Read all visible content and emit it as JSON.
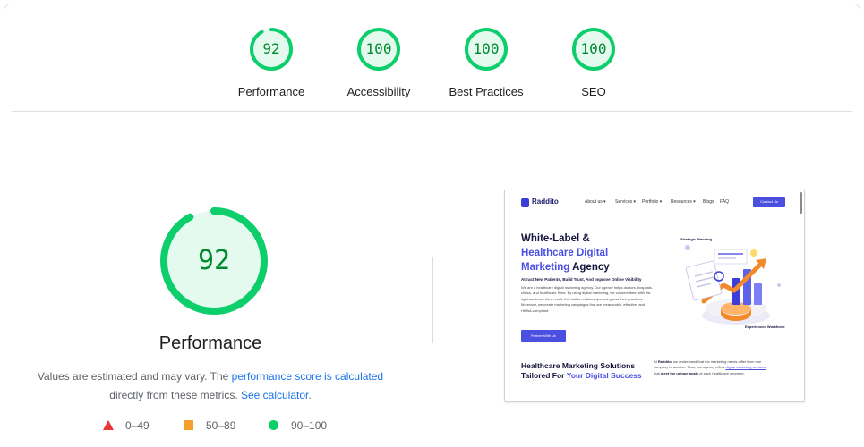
{
  "summary": {
    "categories": [
      {
        "label": "Performance",
        "score": "92",
        "fraction": 0.92
      },
      {
        "label": "Accessibility",
        "score": "100",
        "fraction": 1.0
      },
      {
        "label": "Best Practices",
        "score": "100",
        "fraction": 1.0
      },
      {
        "label": "SEO",
        "score": "100",
        "fraction": 1.0
      }
    ]
  },
  "performance": {
    "score": "92",
    "fraction": 0.92,
    "title": "Performance",
    "note_prefix": "Values are estimated and may vary. The ",
    "note_link1": "performance score is calculated",
    "note_middle": "directly from these metrics. ",
    "note_link2": "See calculator",
    "note_suffix": "."
  },
  "legend": [
    {
      "range": "0–49",
      "shape": "triangle",
      "color": "#e53935"
    },
    {
      "range": "50–89",
      "shape": "square",
      "color": "#f4a02a"
    },
    {
      "range": "90–100",
      "shape": "circle",
      "color": "#0cce6b"
    }
  ],
  "colors": {
    "pass_ring": "#0cce6b",
    "pass_fill": "#e5faef",
    "pass_text": "#008a2f",
    "link": "#1a73e8",
    "brand": "#4b4fe0"
  },
  "thumbnail": {
    "logo": "Raddito",
    "menu": [
      "About us ▾",
      "Services ▾",
      "Portfolio ▾",
      "Resources ▾",
      "Blogs",
      "FAQ"
    ],
    "contact": "Contact Us",
    "hero_line1": "White-Label &",
    "hero_line2": "Healthcare Digital",
    "hero_line3a": "Marketing",
    "hero_line3b": " Agency",
    "hero_sub": "Attract New Patients, Build Trust, And Improve Online Visibility",
    "hero_body": "We are a healthcare digital marketing agency. Our agency helps doctors, hospitals, clinics, and healthcare firms. By using digital marketing, we connect them with the right audience. As a result, this builds relationships and grows their practices. Moreover, we create marketing campaigns that are measurable, effective, and HIPAA-compliant.",
    "hero_btn": "Partner With Us",
    "tag1": "Strategic Planning",
    "tag2": "Experienced Workforce",
    "sec_line1": "Healthcare Marketing Solutions",
    "sec_line2a": "Tailored For ",
    "sec_line2b": "Your Digital Success",
    "sec_body_a": "At ",
    "sec_body_b": "Raddito",
    "sec_body_c": ", we understand that the marketing needs differ from one company to another. Thus, our agency offers ",
    "sec_body_d": "digital marketing services",
    "sec_body_e": " that ",
    "sec_body_f": "meet the unique goals",
    "sec_body_g": " of each healthcare segment."
  }
}
